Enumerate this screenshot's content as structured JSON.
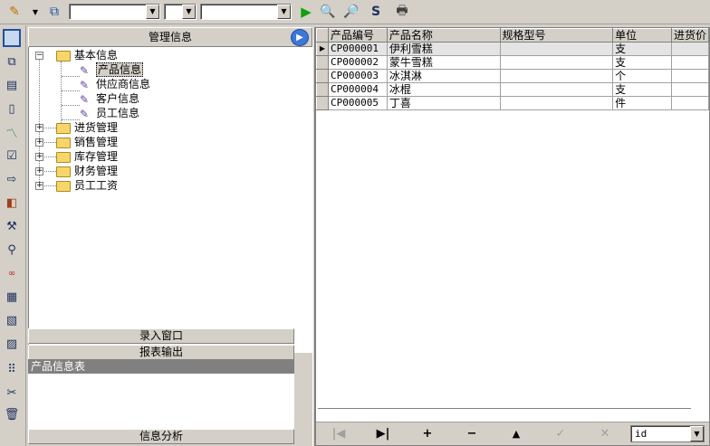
{
  "toolbar": {
    "icons": [
      "pencil-icon",
      "dropdown-arrow-icon",
      "preview-icon",
      "run-icon",
      "find-icon",
      "find-next-icon",
      "replace-icon",
      "print-icon"
    ],
    "combo1": "",
    "combo2": "",
    "combo3": ""
  },
  "left_toolbar": {
    "icons": [
      "window-icon",
      "tree-link-icon",
      "list-icon",
      "document-icon",
      "chart-icon",
      "check-doc-icon",
      "export-icon",
      "layers-icon",
      "tools-icon",
      "search-people-icon",
      "dots-icon",
      "form-icon",
      "report-icon",
      "print-preview-icon",
      "grid-icon",
      "edit-tools-icon",
      "trash-icon"
    ]
  },
  "tree": {
    "header": "管理信息",
    "nodes": [
      {
        "label": "基本信息",
        "type": "folder",
        "expanded": true,
        "children": [
          {
            "label": "产品信息",
            "selected": true
          },
          {
            "label": "供应商信息"
          },
          {
            "label": "客户信息"
          },
          {
            "label": "员工信息"
          }
        ]
      },
      {
        "label": "进货管理",
        "type": "folder",
        "expanded": false
      },
      {
        "label": "销售管理",
        "type": "folder",
        "expanded": false
      },
      {
        "label": "库存管理",
        "type": "folder",
        "expanded": false
      },
      {
        "label": "财务管理",
        "type": "folder",
        "expanded": false
      },
      {
        "label": "员工工资",
        "type": "folder",
        "expanded": false
      }
    ]
  },
  "accordion": {
    "entry_window": "录入窗口",
    "report_output": "报表输出",
    "report_item": "产品信息表",
    "analysis": "信息分析"
  },
  "grid": {
    "columns": [
      "产品编号",
      "产品名称",
      "规格型号",
      "单位",
      "进货价"
    ],
    "rows": [
      {
        "code": "CP000001",
        "name": "伊利雪糕",
        "spec": "",
        "unit": "支",
        "price": ""
      },
      {
        "code": "CP000002",
        "name": "蒙牛雪糕",
        "spec": "",
        "unit": "支",
        "price": ""
      },
      {
        "code": "CP000003",
        "name": "冰淇淋",
        "spec": "",
        "unit": "个",
        "price": ""
      },
      {
        "code": "CP000004",
        "name": "冰棍",
        "spec": "",
        "unit": "支",
        "price": ""
      },
      {
        "code": "CP000005",
        "name": "丁喜",
        "spec": "",
        "unit": "件",
        "price": ""
      }
    ],
    "current_row": 0
  },
  "navigator": {
    "first": "|◀",
    "last": "▶|",
    "insert": "+",
    "delete": "−",
    "edit": "▲",
    "post": "✓",
    "cancel": "✕",
    "field_combo": "id"
  }
}
